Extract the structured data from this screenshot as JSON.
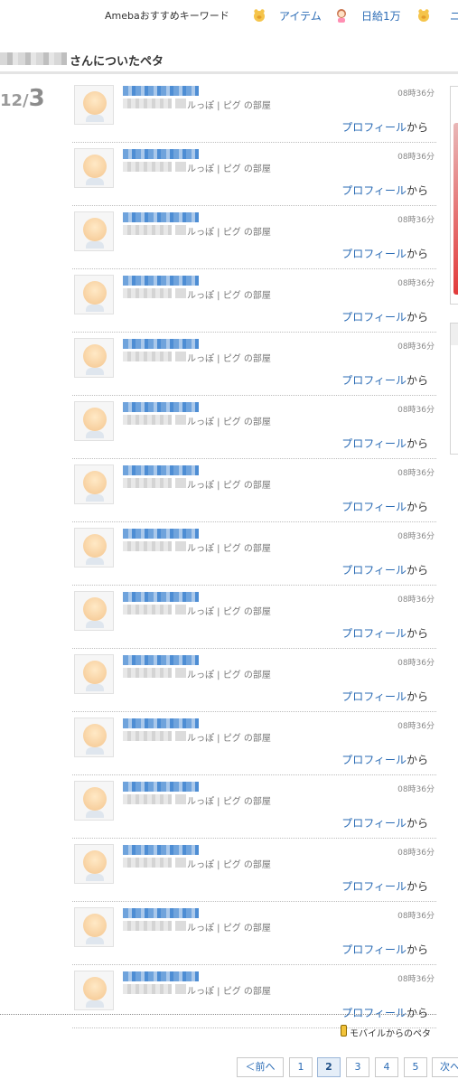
{
  "topnav": {
    "keyword_label": "Amebaおすすめキーワード",
    "links": [
      {
        "icon": "pig-icon",
        "label": "アイテム"
      },
      {
        "icon": "girl-icon",
        "label": "日給1万"
      },
      {
        "icon": "pig-icon",
        "label": "ニ"
      }
    ]
  },
  "section": {
    "title": "さんについたペタ"
  },
  "date": {
    "month_part": "12/",
    "day": "3"
  },
  "entries": [
    {
      "room_text": "ルっぽ | ピグ の部屋",
      "time": "08時36分",
      "profile_link": "プロフィール",
      "from_suffix": "から"
    },
    {
      "room_text": "ルっぽ | ピグ の部屋",
      "time": "08時36分",
      "profile_link": "プロフィール",
      "from_suffix": "から"
    },
    {
      "room_text": "ルっぽ | ピグ の部屋",
      "time": "08時36分",
      "profile_link": "プロフィール",
      "from_suffix": "から"
    },
    {
      "room_text": "ルっぽ | ピグ の部屋",
      "time": "08時36分",
      "profile_link": "プロフィール",
      "from_suffix": "から"
    },
    {
      "room_text": "ルっぽ | ピグ の部屋",
      "time": "08時36分",
      "profile_link": "プロフィール",
      "from_suffix": "から"
    },
    {
      "room_text": "ルっぽ | ピグ の部屋",
      "time": "08時36分",
      "profile_link": "プロフィール",
      "from_suffix": "から"
    },
    {
      "room_text": "ルっぽ | ピグ の部屋",
      "time": "08時36分",
      "profile_link": "プロフィール",
      "from_suffix": "から"
    },
    {
      "room_text": "ルっぽ | ピグ の部屋",
      "time": "08時36分",
      "profile_link": "プロフィール",
      "from_suffix": "から"
    },
    {
      "room_text": "ルっぽ | ピグ の部屋",
      "time": "08時36分",
      "profile_link": "プロフィール",
      "from_suffix": "から"
    },
    {
      "room_text": "ルっぽ | ピグ の部屋",
      "time": "08時36分",
      "profile_link": "プロフィール",
      "from_suffix": "から"
    },
    {
      "room_text": "ルっぽ | ピグ の部屋",
      "time": "08時36分",
      "profile_link": "プロフィール",
      "from_suffix": "から"
    },
    {
      "room_text": "ルっぽ | ピグ の部屋",
      "time": "08時36分",
      "profile_link": "プロフィール",
      "from_suffix": "から"
    },
    {
      "room_text": "ルっぽ | ピグ の部屋",
      "time": "08時36分",
      "profile_link": "プロフィール",
      "from_suffix": "から"
    },
    {
      "room_text": "ルっぽ | ピグ の部屋",
      "time": "08時36分",
      "profile_link": "プロフィール",
      "from_suffix": "から"
    },
    {
      "room_text": "ルっぽ | ピグ の部屋",
      "time": "08時36分",
      "profile_link": "プロフィール",
      "from_suffix": "から"
    }
  ],
  "mobile_label": "モバイルからのペタ",
  "pager": {
    "prev": "＜前へ",
    "pages": [
      "1",
      "2",
      "3",
      "4",
      "5"
    ],
    "current": "2",
    "next": "次へ"
  },
  "colors": {
    "link": "#2a6bb5",
    "date_gray": "#9a9a9a"
  }
}
